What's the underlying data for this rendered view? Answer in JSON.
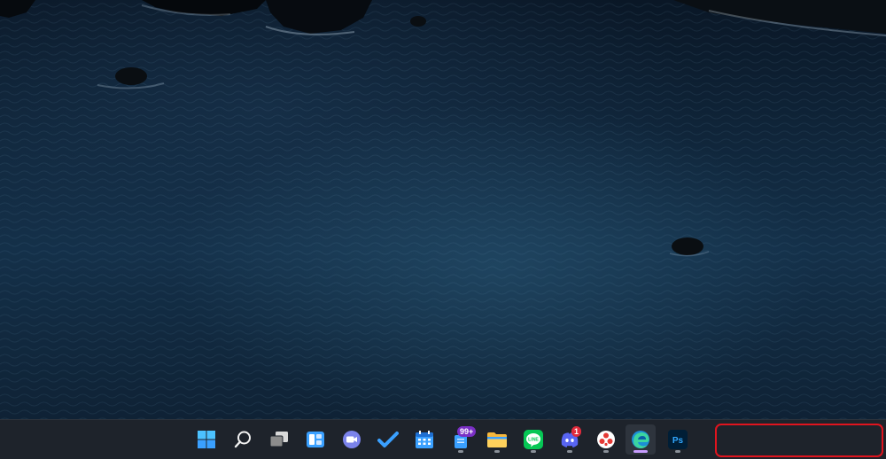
{
  "desktop": {
    "wallpaper": "ocean-aerial"
  },
  "taskbar": {
    "items": [
      {
        "name": "start-button",
        "icon": "windows-logo-icon",
        "running": false
      },
      {
        "name": "search-button",
        "icon": "search-icon",
        "running": false
      },
      {
        "name": "task-view-button",
        "icon": "task-view-icon",
        "running": false
      },
      {
        "name": "widgets-button",
        "icon": "widgets-icon",
        "running": false
      },
      {
        "name": "teams-chat-button",
        "icon": "video-chat-icon",
        "running": false
      },
      {
        "name": "todo-button",
        "icon": "checkmark-icon",
        "running": false
      },
      {
        "name": "calendar-button",
        "icon": "calendar-icon",
        "running": false
      },
      {
        "name": "notes-app-button",
        "icon": "notes-icon",
        "running": true,
        "badge": "99+"
      },
      {
        "name": "file-explorer-button",
        "icon": "folder-icon",
        "running": true
      },
      {
        "name": "line-button",
        "icon": "line-app-icon",
        "running": true,
        "label": "LINE"
      },
      {
        "name": "discord-button",
        "icon": "discord-icon",
        "running": true,
        "badge": "1"
      },
      {
        "name": "app-red-dots-button",
        "icon": "red-dots-icon",
        "running": true
      },
      {
        "name": "edge-button",
        "icon": "edge-browser-icon",
        "running": true,
        "active": true
      },
      {
        "name": "photoshop-button",
        "icon": "photoshop-icon",
        "running": true,
        "label": "Ps"
      }
    ],
    "tray": {
      "highlighted": true,
      "highlight_color": "#e0141e"
    }
  },
  "colors": {
    "taskbar_bg": "#1e232b",
    "accent_blue": "#3aa0ff",
    "badge_purple": "#7a2fc4",
    "badge_red": "#e02b3c",
    "line_green": "#06c755",
    "discord_purple": "#5865f2"
  }
}
